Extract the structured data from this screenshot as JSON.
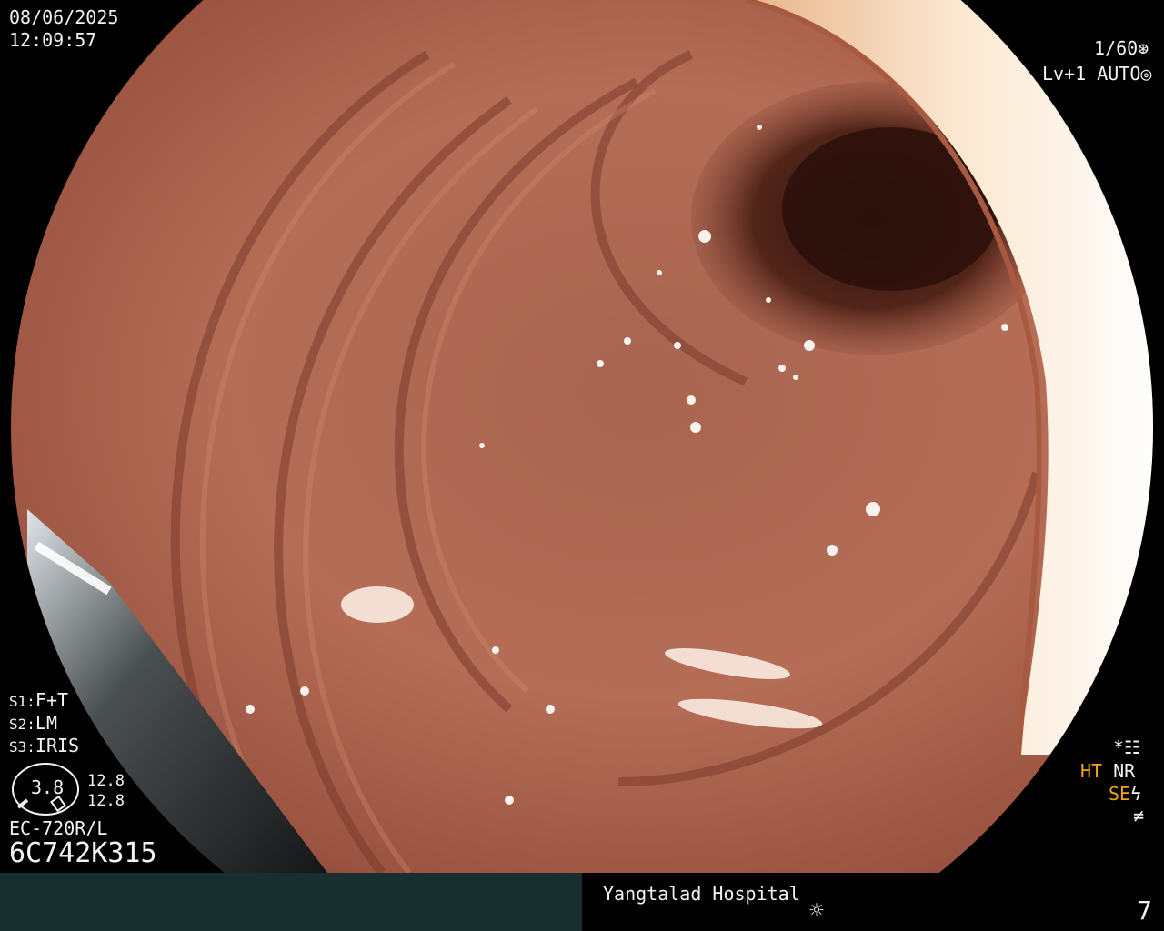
{
  "overlay": {
    "date": "08/06/2025",
    "time": "12:09:57",
    "shutter": "1/60",
    "level": "Lv+1",
    "mode": "AUTO",
    "switches": [
      {
        "key": "S1:",
        "value": "F+T"
      },
      {
        "key": "S2:",
        "value": "LM"
      },
      {
        "key": "S3:",
        "value": "IRIS"
      }
    ],
    "gauge_value": "3.8",
    "gauge_readouts": [
      "12.8",
      "12.8"
    ],
    "scope_model": "EC-720R/L",
    "serial": "6C742K315",
    "right_indicators": {
      "ht": "HT",
      "nr": "NR",
      "se": "SE"
    }
  },
  "footer": {
    "hospital": "Yangtalad Hospital",
    "page": "7"
  },
  "colors": {
    "accent_orange": "#f2a21c",
    "footer_bar": "#17302f"
  }
}
